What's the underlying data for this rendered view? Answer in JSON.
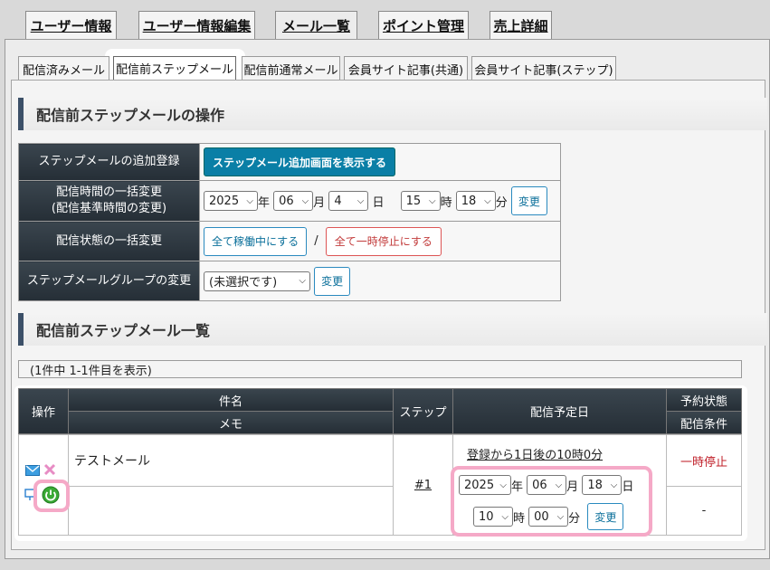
{
  "top_tabs": [
    "ユーザー情報",
    "ユーザー情報編集",
    "メール一覧",
    "ポイント管理",
    "売上詳細"
  ],
  "sub_tabs": [
    "配信済みメール",
    "配信前ステップメール",
    "配信前通常メール",
    "会員サイト記事(共通)",
    "会員サイト記事(ステップ)"
  ],
  "ops_section": {
    "title": "配信前ステップメールの操作",
    "rows": {
      "add_label": "ステップメールの追加登録",
      "add_button": "ステップメール追加画面を表示する",
      "time_label_1": "配信時間の一括変更",
      "time_label_2": "(配信基準時間の変更)",
      "year": "2025",
      "year_unit": "年",
      "month": "06",
      "month_unit": "月",
      "day": "4",
      "day_unit": "日",
      "hour": "15",
      "hour_unit": "時",
      "minute": "18",
      "minute_unit": "分",
      "change_label": "変更",
      "status_label": "配信状態の一括変更",
      "all_active_button": "全て稼働中にする",
      "separator": "/",
      "all_pause_button": "全て一時停止にする",
      "group_label": "ステップメールグループの変更",
      "group_select": "(未選択です)"
    }
  },
  "list_section": {
    "title": "配信前ステップメール一覧",
    "count_text": "(1件中 1-1件目を表示)",
    "headers": {
      "op": "操作",
      "subject": "件名",
      "memo": "メモ",
      "step": "ステップ",
      "schedule": "配信予定日",
      "reserve_status": "予約状態",
      "condition": "配信条件"
    },
    "row": {
      "subject": "テストメール",
      "step": "#1",
      "schedule_text": "登録から1日後の10時0分",
      "year": "2025",
      "year_unit": "年",
      "month": "06",
      "month_unit": "月",
      "day": "18",
      "day_unit": "日",
      "hour": "10",
      "hour_unit": "時",
      "minute": "00",
      "minute_unit": "分",
      "change_label": "変更",
      "status": "一時停止",
      "condition": "-"
    }
  },
  "colors": {
    "header_dark": "#2e3942",
    "teal_button": "#0a7fa6",
    "status_red": "#c0202a",
    "highlight_pink": "#f5a9c7",
    "power_green": "#3aa935"
  }
}
